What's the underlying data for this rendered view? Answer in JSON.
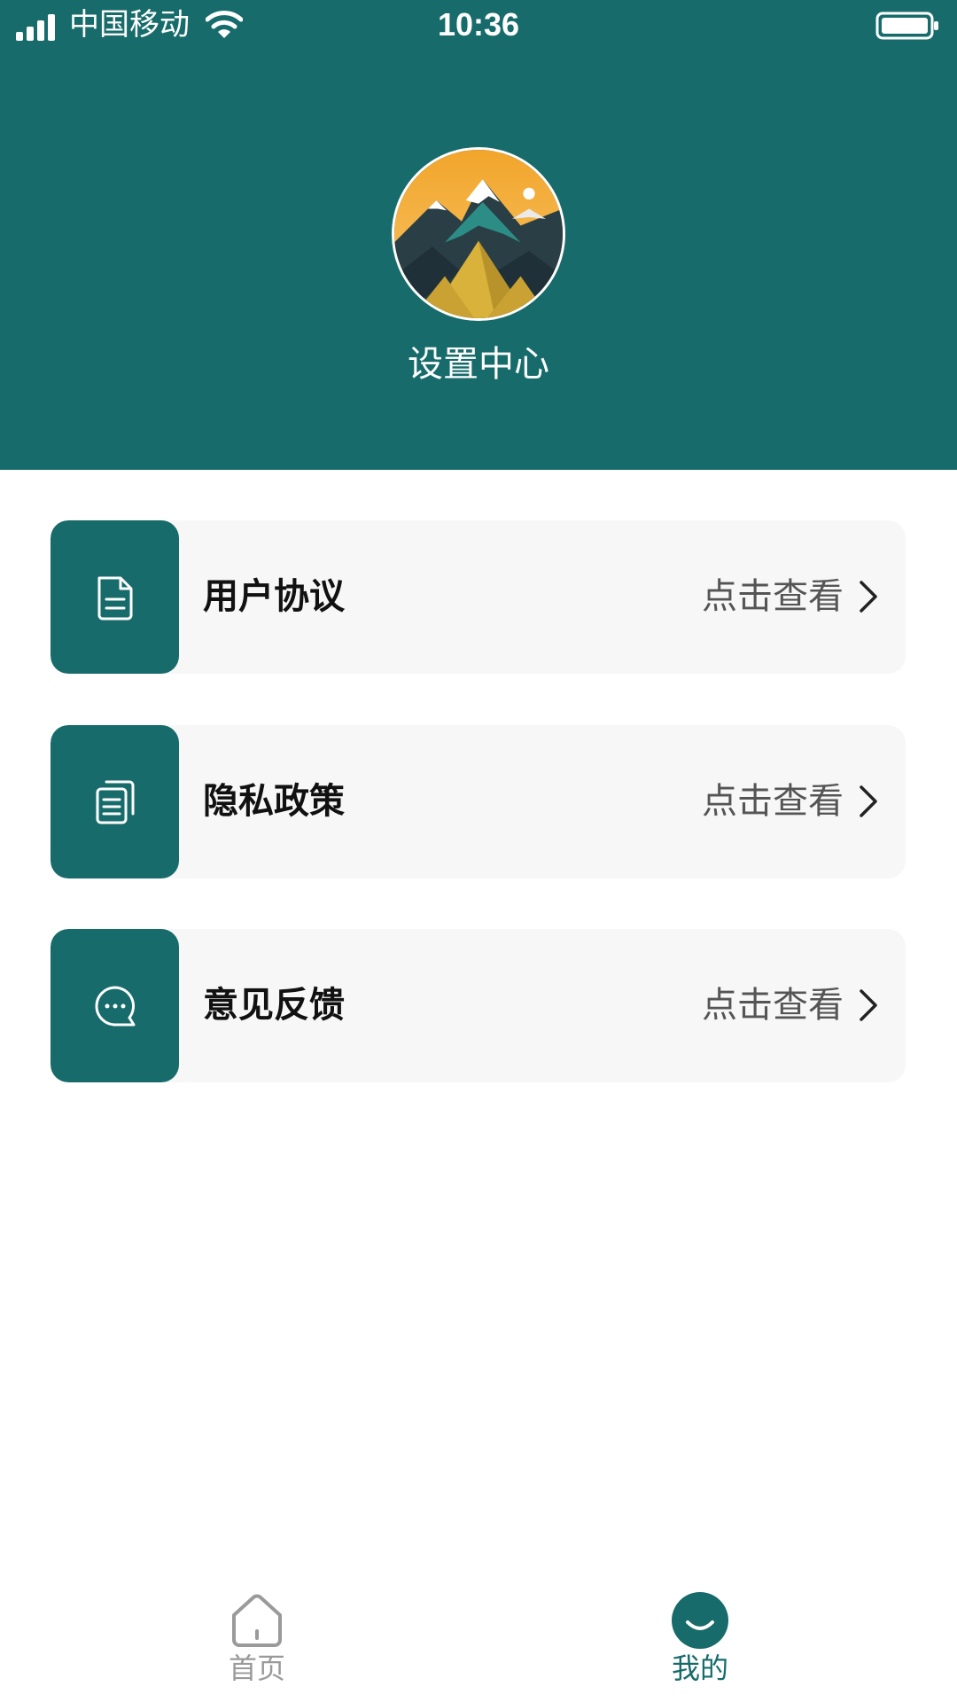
{
  "status_bar": {
    "carrier": "中国移动",
    "time": "10:36"
  },
  "header": {
    "title": "设置中心"
  },
  "menu": [
    {
      "label": "用户协议",
      "action": "点击查看",
      "icon": "document-icon"
    },
    {
      "label": "隐私政策",
      "action": "点击查看",
      "icon": "documents-stack-icon"
    },
    {
      "label": "意见反馈",
      "action": "点击查看",
      "icon": "chat-bubble-icon"
    }
  ],
  "tabbar": {
    "tabs": [
      {
        "label": "首页",
        "icon": "home-icon",
        "active": false
      },
      {
        "label": "我的",
        "icon": "smile-icon",
        "active": true
      }
    ]
  },
  "colors": {
    "primary": "#176B6B",
    "card_bg": "#F7F7F7",
    "inactive": "#9A9A9A"
  }
}
